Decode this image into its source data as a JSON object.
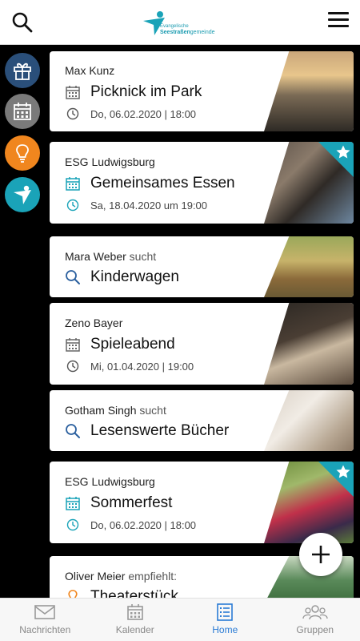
{
  "header": {
    "logo_small": "Evangelische",
    "logo_bold": "Seestraßen",
    "logo_rest": "gemeinde"
  },
  "rail": [
    {
      "icon": "gift-icon",
      "color": "#2a4f7a"
    },
    {
      "icon": "calendar-icon",
      "color": "#7a7a7a"
    },
    {
      "icon": "lightbulb-icon",
      "color": "#f0861e"
    },
    {
      "icon": "ok-logo-icon",
      "color": "#1aa3b8"
    }
  ],
  "cards": [
    {
      "author": "Max Kunz",
      "suffix": "",
      "type": "event",
      "title": "Picknick im Park",
      "meta": "Do, 06.02.2020 | 18:00",
      "starred": false
    },
    {
      "author": "ESG Ludwigsburg",
      "suffix": "",
      "type": "event",
      "title": "Gemeinsames Essen",
      "meta": "Sa, 18.04.2020 um 19:00",
      "starred": true
    },
    {
      "author": "Mara Weber",
      "suffix": "sucht",
      "type": "search",
      "title": "Kinderwagen",
      "meta": "",
      "starred": false
    },
    {
      "author": "Zeno Bayer",
      "suffix": "",
      "type": "event",
      "title": "Spieleabend",
      "meta": "Mi, 01.04.2020 | 19:00",
      "starred": false
    },
    {
      "author": "Gotham Singh",
      "suffix": "sucht",
      "type": "search",
      "title": "Lesenswerte Bücher",
      "meta": "",
      "starred": false
    },
    {
      "author": "ESG Ludwigsburg",
      "suffix": "",
      "type": "event",
      "title": "Sommerfest",
      "meta": "Do, 06.02.2020 | 18:00",
      "starred": true
    },
    {
      "author": "Oliver Meier",
      "suffix": "empfiehlt:",
      "type": "recommend",
      "title": "Theaterstück",
      "meta": "",
      "starred": false
    }
  ],
  "bottomnav": [
    {
      "label": "Nachrichten",
      "icon": "mail-icon",
      "active": false
    },
    {
      "label": "Kalender",
      "icon": "calendar-icon",
      "active": false
    },
    {
      "label": "Home",
      "icon": "list-icon",
      "active": true
    },
    {
      "label": "Gruppen",
      "icon": "group-icon",
      "active": false
    }
  ],
  "colors": {
    "accent": "#1aa3b8",
    "active_nav": "#2a7bd5"
  }
}
